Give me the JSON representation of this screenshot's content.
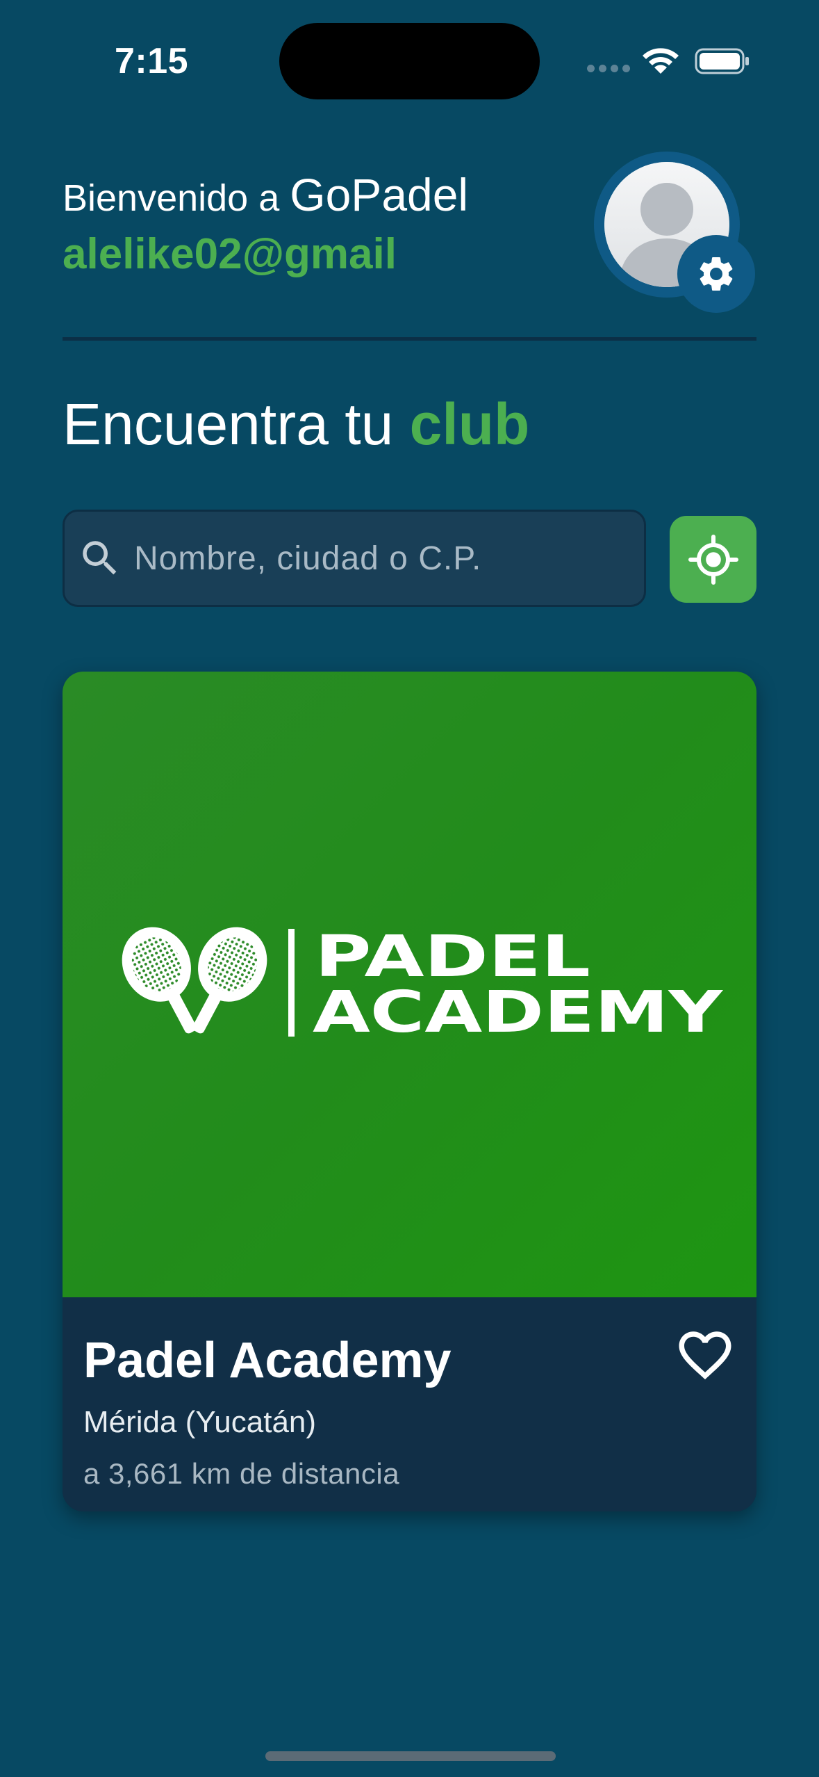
{
  "status_bar": {
    "time": "7:15",
    "icons": [
      "signal-dots",
      "wifi-icon",
      "battery-icon"
    ]
  },
  "header": {
    "welcome_prefix": "Bienvenido a ",
    "app_name": "GoPadel",
    "user_email": "alelike02@gmail",
    "avatar_icon": "person-silhouette",
    "settings_icon": "gear-icon"
  },
  "search_section": {
    "title_prefix": "Encuentra tu ",
    "title_accent": "club",
    "search_placeholder": "Nombre, ciudad o C.P.",
    "search_icon": "search-icon",
    "locate_icon": "location-target-icon"
  },
  "clubs": [
    {
      "logo_line1": "PADEL",
      "logo_line2": "ACADEMY",
      "name": "Padel Academy",
      "location": "Mérida (Yucatán)",
      "distance": "a 3,661 km de distancia",
      "favorite_icon": "heart-outline-icon"
    }
  ],
  "colors": {
    "background": "#074963",
    "accent": "#4caf50",
    "card_info_bg": "#112f47",
    "search_bg": "#193f57"
  }
}
